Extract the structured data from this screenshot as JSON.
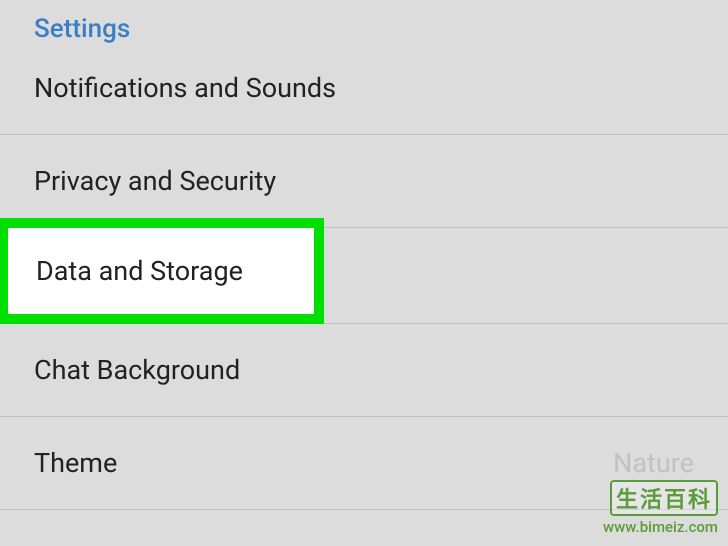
{
  "header": {
    "title": "Settings"
  },
  "settings": {
    "items": [
      {
        "label": "Notifications and Sounds"
      },
      {
        "label": "Privacy and Security"
      },
      {
        "label": "Data and Storage"
      },
      {
        "label": "Chat Background"
      },
      {
        "label": "Theme",
        "value": "Nature"
      }
    ]
  },
  "watermark": {
    "cn": "生活百科",
    "url": "www.bimeiz.com"
  }
}
